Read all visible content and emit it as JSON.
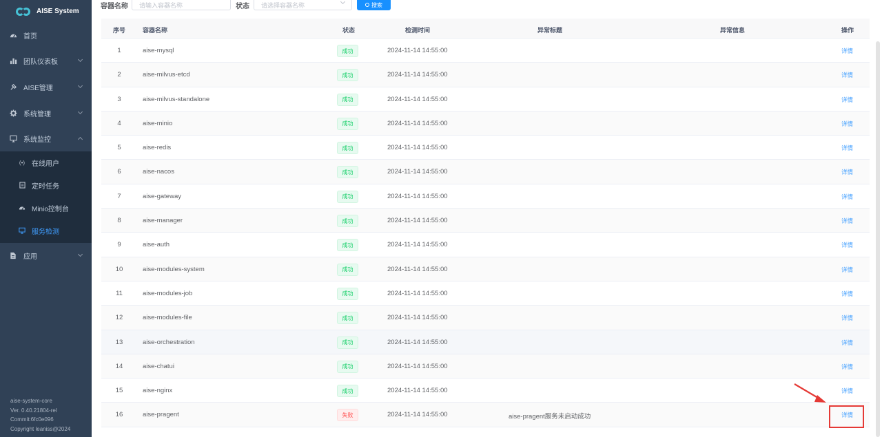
{
  "app": {
    "title": "AISE System"
  },
  "sidebar": {
    "items": [
      {
        "label": "首页",
        "icon": "dashboard-icon"
      },
      {
        "label": "团队仪表板",
        "icon": "bar-chart-icon"
      },
      {
        "label": "AISE管理",
        "icon": "tool-icon"
      },
      {
        "label": "系统管理",
        "icon": "gear-icon"
      },
      {
        "label": "系统监控",
        "icon": "monitor-icon"
      },
      {
        "label": "应用",
        "icon": "document-icon"
      }
    ],
    "submenu": [
      {
        "label": "在线用户",
        "icon": "online-icon"
      },
      {
        "label": "定时任务",
        "icon": "job-icon"
      },
      {
        "label": "Minio控制台",
        "icon": "dashboard-icon"
      },
      {
        "label": "服务检测",
        "icon": "monitor-icon"
      }
    ],
    "version": {
      "name": "aise-system-core",
      "ver": "Ver. 0.40.21804-rel",
      "commit": "Commit:6fc0e096",
      "copyright": "Copyright leaniss@2024"
    }
  },
  "search": {
    "name_label": "容器名称",
    "name_placeholder": "请输入容器名称",
    "status_label": "状态",
    "status_placeholder": "请选择容器名称",
    "button": "搜索"
  },
  "table": {
    "headers": {
      "idx": "序号",
      "name": "容器名称",
      "status": "状态",
      "time": "检测时间",
      "title": "异常标题",
      "info": "异常信息",
      "op": "操作"
    },
    "rows": [
      {
        "idx": "1",
        "name": "aise-mysql",
        "status": "成功",
        "time": "2024-11-14 14:55:00",
        "title": "",
        "op": "详情"
      },
      {
        "idx": "2",
        "name": "aise-milvus-etcd",
        "status": "成功",
        "time": "2024-11-14 14:55:00",
        "title": "",
        "op": "详情"
      },
      {
        "idx": "3",
        "name": "aise-milvus-standalone",
        "status": "成功",
        "time": "2024-11-14 14:55:00",
        "title": "",
        "op": "详情"
      },
      {
        "idx": "4",
        "name": "aise-minio",
        "status": "成功",
        "time": "2024-11-14 14:55:00",
        "title": "",
        "op": "详情"
      },
      {
        "idx": "5",
        "name": "aise-redis",
        "status": "成功",
        "time": "2024-11-14 14:55:00",
        "title": "",
        "op": "详情"
      },
      {
        "idx": "6",
        "name": "aise-nacos",
        "status": "成功",
        "time": "2024-11-14 14:55:00",
        "title": "",
        "op": "详情"
      },
      {
        "idx": "7",
        "name": "aise-gateway",
        "status": "成功",
        "time": "2024-11-14 14:55:00",
        "title": "",
        "op": "详情"
      },
      {
        "idx": "8",
        "name": "aise-manager",
        "status": "成功",
        "time": "2024-11-14 14:55:00",
        "title": "",
        "op": "详情"
      },
      {
        "idx": "9",
        "name": "aise-auth",
        "status": "成功",
        "time": "2024-11-14 14:55:00",
        "title": "",
        "op": "详情"
      },
      {
        "idx": "10",
        "name": "aise-modules-system",
        "status": "成功",
        "time": "2024-11-14 14:55:00",
        "title": "",
        "op": "详情"
      },
      {
        "idx": "11",
        "name": "aise-modules-job",
        "status": "成功",
        "time": "2024-11-14 14:55:00",
        "title": "",
        "op": "详情"
      },
      {
        "idx": "12",
        "name": "aise-modules-file",
        "status": "成功",
        "time": "2024-11-14 14:55:00",
        "title": "",
        "op": "详情"
      },
      {
        "idx": "13",
        "name": "aise-orchestration",
        "status": "成功",
        "time": "2024-11-14 14:55:00",
        "title": "",
        "op": "详情"
      },
      {
        "idx": "14",
        "name": "aise-chatui",
        "status": "成功",
        "time": "2024-11-14 14:55:00",
        "title": "",
        "op": "详情"
      },
      {
        "idx": "15",
        "name": "aise-nginx",
        "status": "成功",
        "time": "2024-11-14 14:55:00",
        "title": "",
        "op": "详情"
      },
      {
        "idx": "16",
        "name": "aise-pragent",
        "status": "失败",
        "time": "2024-11-14 14:55:00",
        "title": "aise-pragent服务未启动成功",
        "op": "详情"
      }
    ]
  },
  "colors": {
    "sidebar_bg": "#304156",
    "submenu_bg": "#1f2d3d",
    "accent": "#409eff",
    "success": "#13ce66",
    "danger": "#ff4949",
    "annotation": "#e53935"
  }
}
